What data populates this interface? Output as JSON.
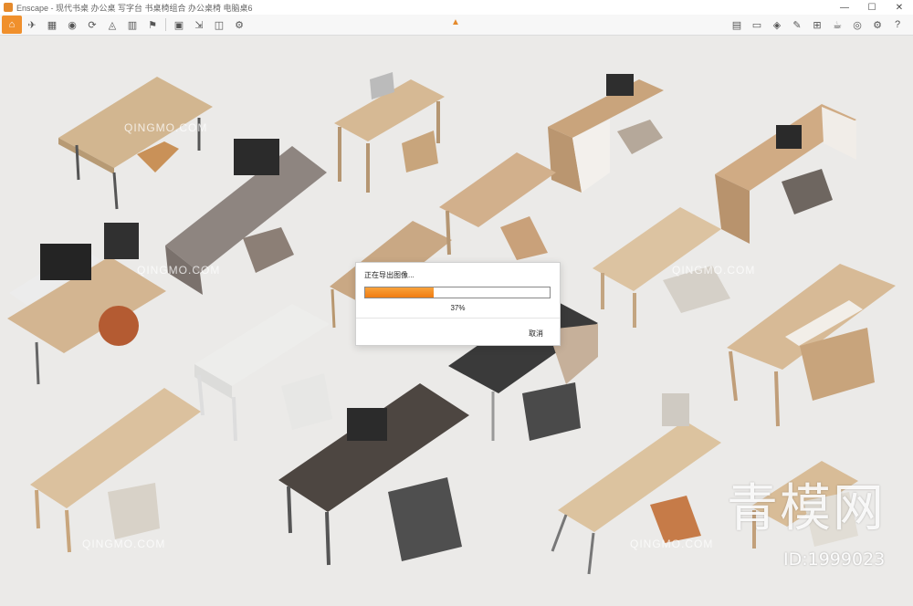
{
  "window": {
    "title": "Enscape - 现代书桌 办公桌 写字台 书桌椅组合 办公桌椅 电脑桌6",
    "controls": [
      "—",
      "☐",
      "✕"
    ]
  },
  "toolbar": {
    "accent_color": "#f0902c",
    "left_icons": [
      "home-icon",
      "walk-icon",
      "bim-icon",
      "video-icon",
      "sync-icon",
      "asset-icon",
      "building-icon",
      "flag-icon",
      "render-icon",
      "export-icon",
      "panorama-icon",
      "settings-icon"
    ],
    "right_icons": [
      "views-icon",
      "monitor-icon",
      "cube-icon",
      "library-icon",
      "grid-icon",
      "cup-icon",
      "eye-icon",
      "gear-icon",
      "help-icon"
    ]
  },
  "dialog": {
    "title": "正在导出图像...",
    "progress_percent": 37,
    "progress_label": "37%",
    "cancel_label": "取消",
    "progress_color": "#f07c12"
  },
  "watermarks": {
    "tile_text": "QINGMO.COM",
    "brand_text": "青模网",
    "id_text": "ID:1999023"
  }
}
